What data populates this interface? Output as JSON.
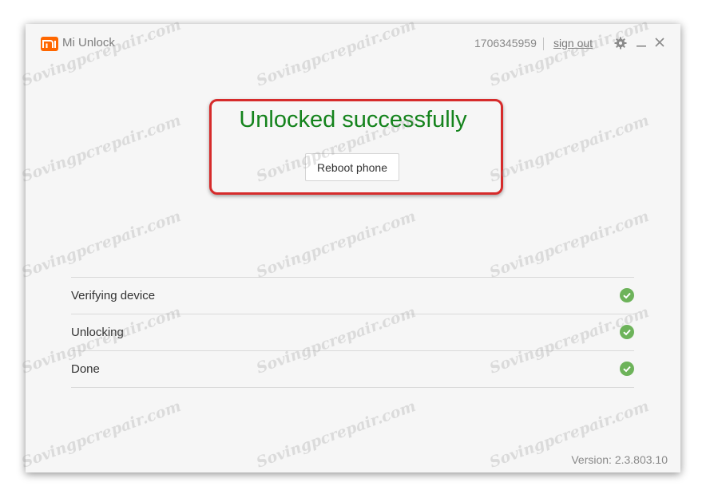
{
  "app": {
    "title": "Mi Unlock",
    "logo_text": "mi",
    "brand_color": "#ff6700"
  },
  "header": {
    "account_id": "1706345959",
    "sign_out_label": "sign out",
    "controls": [
      "gear-icon",
      "minimize-icon",
      "close-icon"
    ]
  },
  "result": {
    "message": "Unlocked successfully",
    "message_color": "#14831c",
    "reboot_button_label": "Reboot phone",
    "highlight_color": "#d62b2b"
  },
  "steps": [
    {
      "label": "Verifying device",
      "status": "check-icon"
    },
    {
      "label": "Unlocking",
      "status": "check-icon"
    },
    {
      "label": "Done",
      "status": "check-icon"
    }
  ],
  "status_color": "#6db35a",
  "footer": {
    "version": "Version: 2.3.803.10"
  },
  "watermark": {
    "text": "Sovingpcrepair.com"
  }
}
